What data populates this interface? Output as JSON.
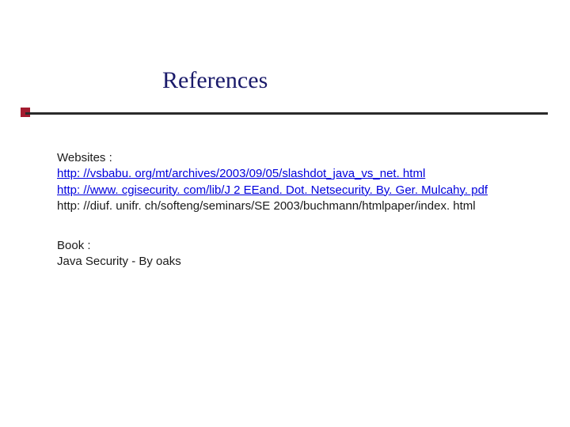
{
  "title": "References",
  "websites": {
    "heading": "Websites :",
    "links": {
      "l1": "http: //vsbabu. org/mt/archives/2003/09/05/slashdot_java_vs_net. html",
      "l2": "http: //www. cgisecurity. com/lib/J 2 EEand. Dot. Netsecurity. By. Ger. Mulcahy. pdf",
      "l3": "http: //diuf. unifr. ch/softeng/seminars/SE 2003/buchmann/htmlpaper/index. html"
    }
  },
  "book": {
    "heading": "Book :",
    "entry": "Java Security  - By oaks"
  }
}
